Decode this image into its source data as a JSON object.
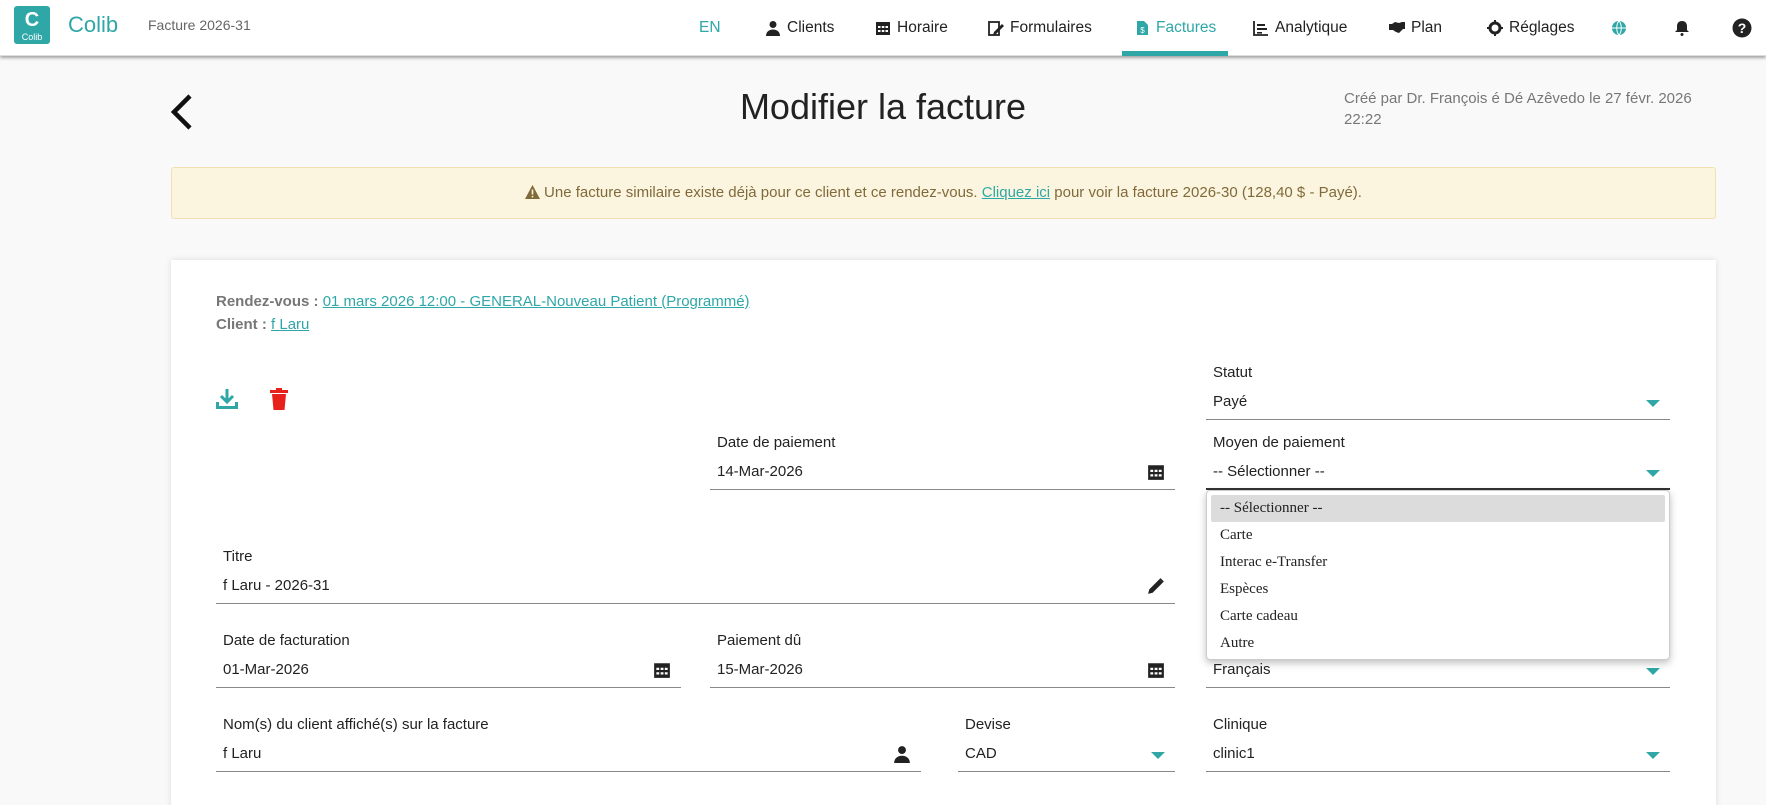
{
  "app": {
    "brand": "Colib",
    "logo_letter": "C",
    "logo_small": "Colib",
    "crumb": "Facture 2026-31"
  },
  "nav": {
    "lang": "EN",
    "items": [
      {
        "label": "Clients",
        "icon": "user-icon"
      },
      {
        "label": "Horaire",
        "icon": "calendar-icon"
      },
      {
        "label": "Formulaires",
        "icon": "form-edit-icon"
      },
      {
        "label": "Factures",
        "icon": "invoice-icon",
        "active": true
      },
      {
        "label": "Analytique",
        "icon": "chart-icon"
      },
      {
        "label": "Plan",
        "icon": "handshake-icon"
      },
      {
        "label": "Réglages",
        "icon": "gear-icon"
      }
    ]
  },
  "header": {
    "title": "Modifier la facture",
    "created": "Créé par Dr. François é Dé Azêvedo le 27 févr. 2026 22:22"
  },
  "alert": {
    "before": "Une facture similaire existe déjà pour ce client et ce rendez-vous.",
    "link": "Cliquez ici",
    "after": "pour voir la facture 2026-30 (128,40 $ - Payé)."
  },
  "invoice": {
    "appointment_label": "Rendez-vous :",
    "appointment_value": "01 mars 2026 12:00 - GENERAL-Nouveau Patient (Programmé)",
    "client_label": "Client :",
    "client_value": "f Laru",
    "status": {
      "label": "Statut",
      "value": "Payé"
    },
    "payment_date": {
      "label": "Date de paiement",
      "value": "14-Mar-2026"
    },
    "payment_method": {
      "label": "Moyen de paiement",
      "value": "-- Sélectionner --"
    },
    "title": {
      "label": "Titre",
      "value": "f Laru - 2026-31"
    },
    "billing_date": {
      "label": "Date de facturation",
      "value": "01-Mar-2026"
    },
    "due_date": {
      "label": "Paiement dû",
      "value": "15-Mar-2026"
    },
    "language": {
      "value": "Français"
    },
    "client_names": {
      "label": "Nom(s) du client affiché(s) sur la facture",
      "value": "f Laru"
    },
    "currency": {
      "label": "Devise",
      "value": "CAD"
    },
    "clinic": {
      "label": "Clinique",
      "value": "clinic1"
    }
  },
  "payment_options": [
    "-- Sélectionner --",
    "Carte",
    "Interac e-Transfer",
    "Espèces",
    "Carte cadeau",
    "Autre"
  ],
  "colors": {
    "accent": "#2fa7a7",
    "danger": "#e8201c",
    "alert_bg": "#fbf5df"
  }
}
